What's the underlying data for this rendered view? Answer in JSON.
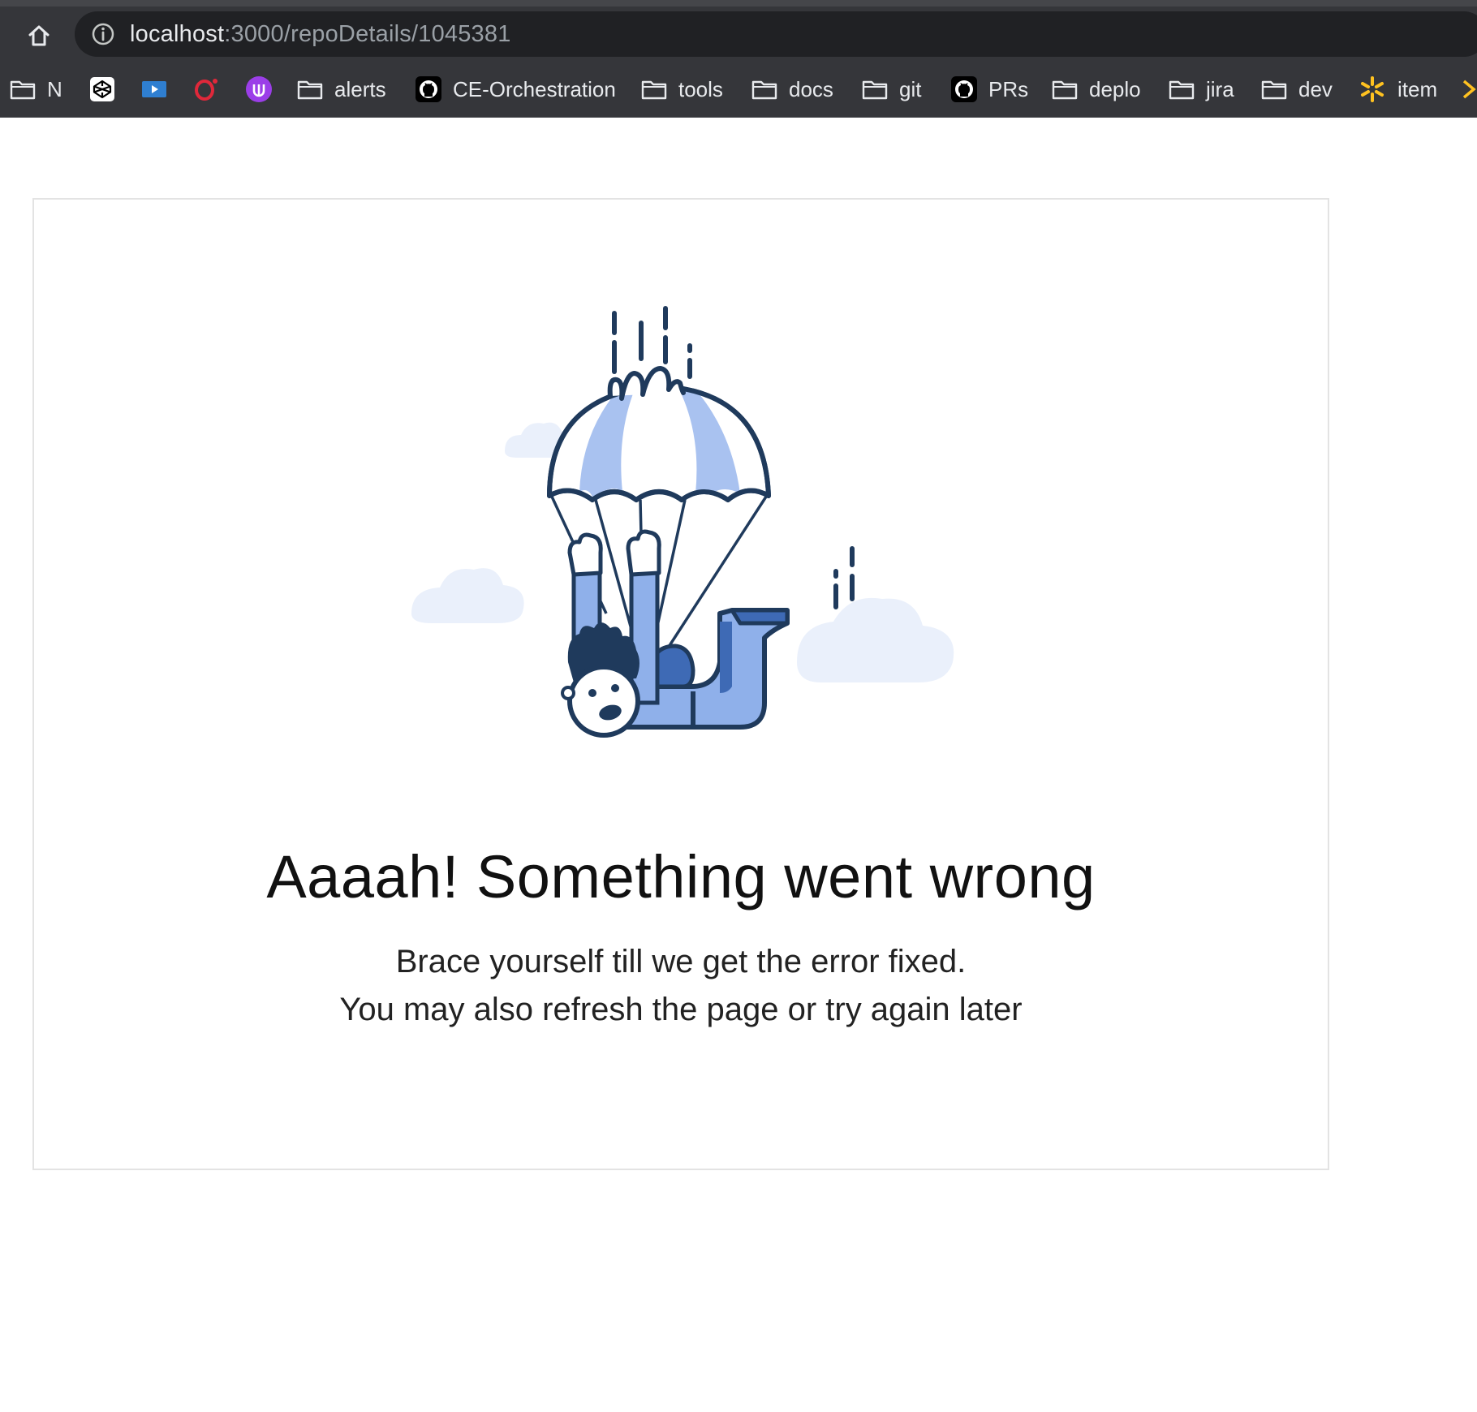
{
  "browser": {
    "url_host": "localhost",
    "url_rest": ":3000/repoDetails/1045381",
    "bookmarks": [
      {
        "label": "N",
        "icon": "folder-icon"
      },
      {
        "label": "",
        "icon": "codepen-icon"
      },
      {
        "label": "",
        "icon": "video-player-icon"
      },
      {
        "label": "",
        "icon": "opera-icon"
      },
      {
        "label": "",
        "icon": "purple-u-icon"
      },
      {
        "label": "alerts",
        "icon": "folder-icon"
      },
      {
        "label": "CE-Orchestration",
        "icon": "github-icon"
      },
      {
        "label": "tools",
        "icon": "folder-icon"
      },
      {
        "label": "docs",
        "icon": "folder-icon"
      },
      {
        "label": "git",
        "icon": "folder-icon"
      },
      {
        "label": "PRs",
        "icon": "github-icon"
      },
      {
        "label": "deplo",
        "icon": "folder-icon"
      },
      {
        "label": "jira",
        "icon": "folder-icon"
      },
      {
        "label": "dev",
        "icon": "folder-icon"
      },
      {
        "label": "item",
        "icon": "walmart-spark-icon"
      }
    ]
  },
  "error": {
    "title": "Aaaah! Something went wrong",
    "line1": "Brace yourself till we get the error fixed.",
    "line2": "You may also refresh the page or try again later"
  },
  "colors": {
    "chrome_dark": "#35363a",
    "omnibox": "#202124",
    "illustration_stroke": "#1f3a5c",
    "illustration_light_blue": "#a9c2f0",
    "illustration_blue": "#8fb0ea",
    "illustration_dark_blue": "#3e6ab5",
    "cloud": "#eaf0fb"
  }
}
